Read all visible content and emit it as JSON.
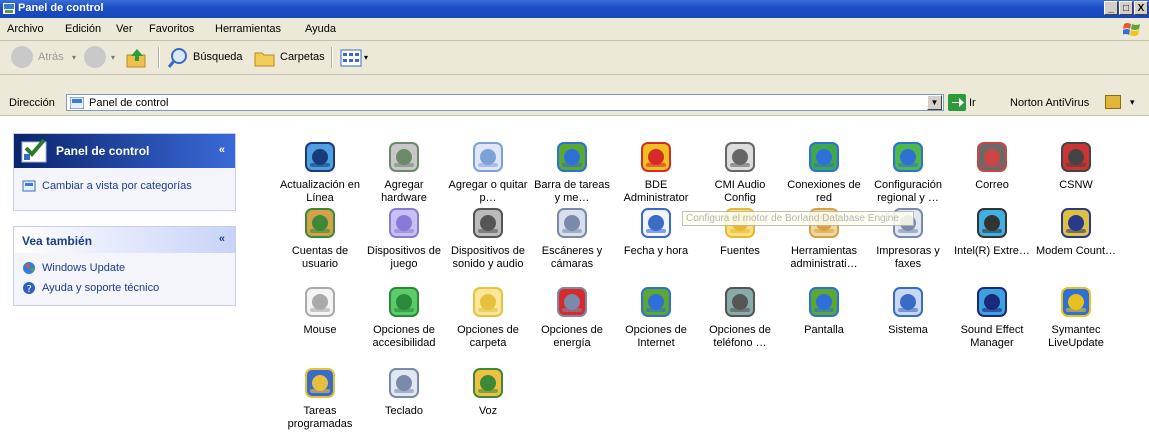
{
  "window": {
    "title": "Panel de control",
    "min": "_",
    "max": "□",
    "close": "X"
  },
  "menu": [
    "Archivo",
    "Edición",
    "Ver",
    "Favoritos",
    "Herramientas",
    "Ayuda"
  ],
  "toolbar": {
    "back": "Atrás",
    "search": "Búsqueda",
    "folders": "Carpetas"
  },
  "address": {
    "label": "Dirección",
    "value": "Panel de control",
    "go": "Ir",
    "norton": "Norton AntiVirus"
  },
  "taskpane": {
    "main_title": "Panel de control",
    "switch_view": "Cambiar a vista por categorías",
    "see_also_title": "Vea también",
    "links": [
      "Windows Update",
      "Ayuda y soporte técnico"
    ],
    "chevron": "«"
  },
  "tooltip": "Configura el motor de Borland Database Engine",
  "items": [
    {
      "label": "Actualización en Línea",
      "icon": "update-icon"
    },
    {
      "label": "Agregar hardware",
      "icon": "add-hardware-icon"
    },
    {
      "label": "Agregar o quitar p…",
      "icon": "add-remove-programs-icon"
    },
    {
      "label": "Barra de tareas y me…",
      "icon": "taskbar-icon"
    },
    {
      "label": "BDE Administrator",
      "icon": "bde-icon"
    },
    {
      "label": "CMI Audio Config",
      "icon": "audio-config-icon"
    },
    {
      "label": "Conexiones de red",
      "icon": "network-icon"
    },
    {
      "label": "Configuración regional y …",
      "icon": "regional-icon"
    },
    {
      "label": "Correo",
      "icon": "mail-icon"
    },
    {
      "label": "CSNW",
      "icon": "csnw-icon"
    },
    {
      "label": "Cuentas de usuario",
      "icon": "user-accounts-icon"
    },
    {
      "label": "Dispositivos de juego",
      "icon": "game-controller-icon"
    },
    {
      "label": "Dispositivos de sonido y audio",
      "icon": "speaker-icon"
    },
    {
      "label": "Escáneres y cámaras",
      "icon": "scanner-icon"
    },
    {
      "label": "Fecha y hora",
      "icon": "clock-icon"
    },
    {
      "label": "Fuentes",
      "icon": "fonts-folder-icon"
    },
    {
      "label": "Herramientas administrati…",
      "icon": "admin-tools-icon"
    },
    {
      "label": "Impresoras y faxes",
      "icon": "printer-icon"
    },
    {
      "label": "Intel(R) Extre…",
      "icon": "intel-graphics-icon"
    },
    {
      "label": "Modem Count…",
      "icon": "modem-icon"
    },
    {
      "label": "Mouse",
      "icon": "mouse-icon"
    },
    {
      "label": "Opciones de accesibilidad",
      "icon": "accessibility-icon"
    },
    {
      "label": "Opciones de carpeta",
      "icon": "folder-options-icon"
    },
    {
      "label": "Opciones de energía",
      "icon": "power-icon"
    },
    {
      "label": "Opciones de Internet",
      "icon": "internet-icon"
    },
    {
      "label": "Opciones de teléfono …",
      "icon": "phone-icon"
    },
    {
      "label": "Pantalla",
      "icon": "display-icon"
    },
    {
      "label": "Sistema",
      "icon": "system-icon"
    },
    {
      "label": "Sound Effect Manager",
      "icon": "sound-effect-icon"
    },
    {
      "label": "Symantec LiveUpdate",
      "icon": "liveupdate-icon"
    },
    {
      "label": "Tareas programadas",
      "icon": "scheduled-tasks-icon"
    },
    {
      "label": "Teclado",
      "icon": "keyboard-icon"
    },
    {
      "label": "Voz",
      "icon": "speech-icon"
    }
  ]
}
